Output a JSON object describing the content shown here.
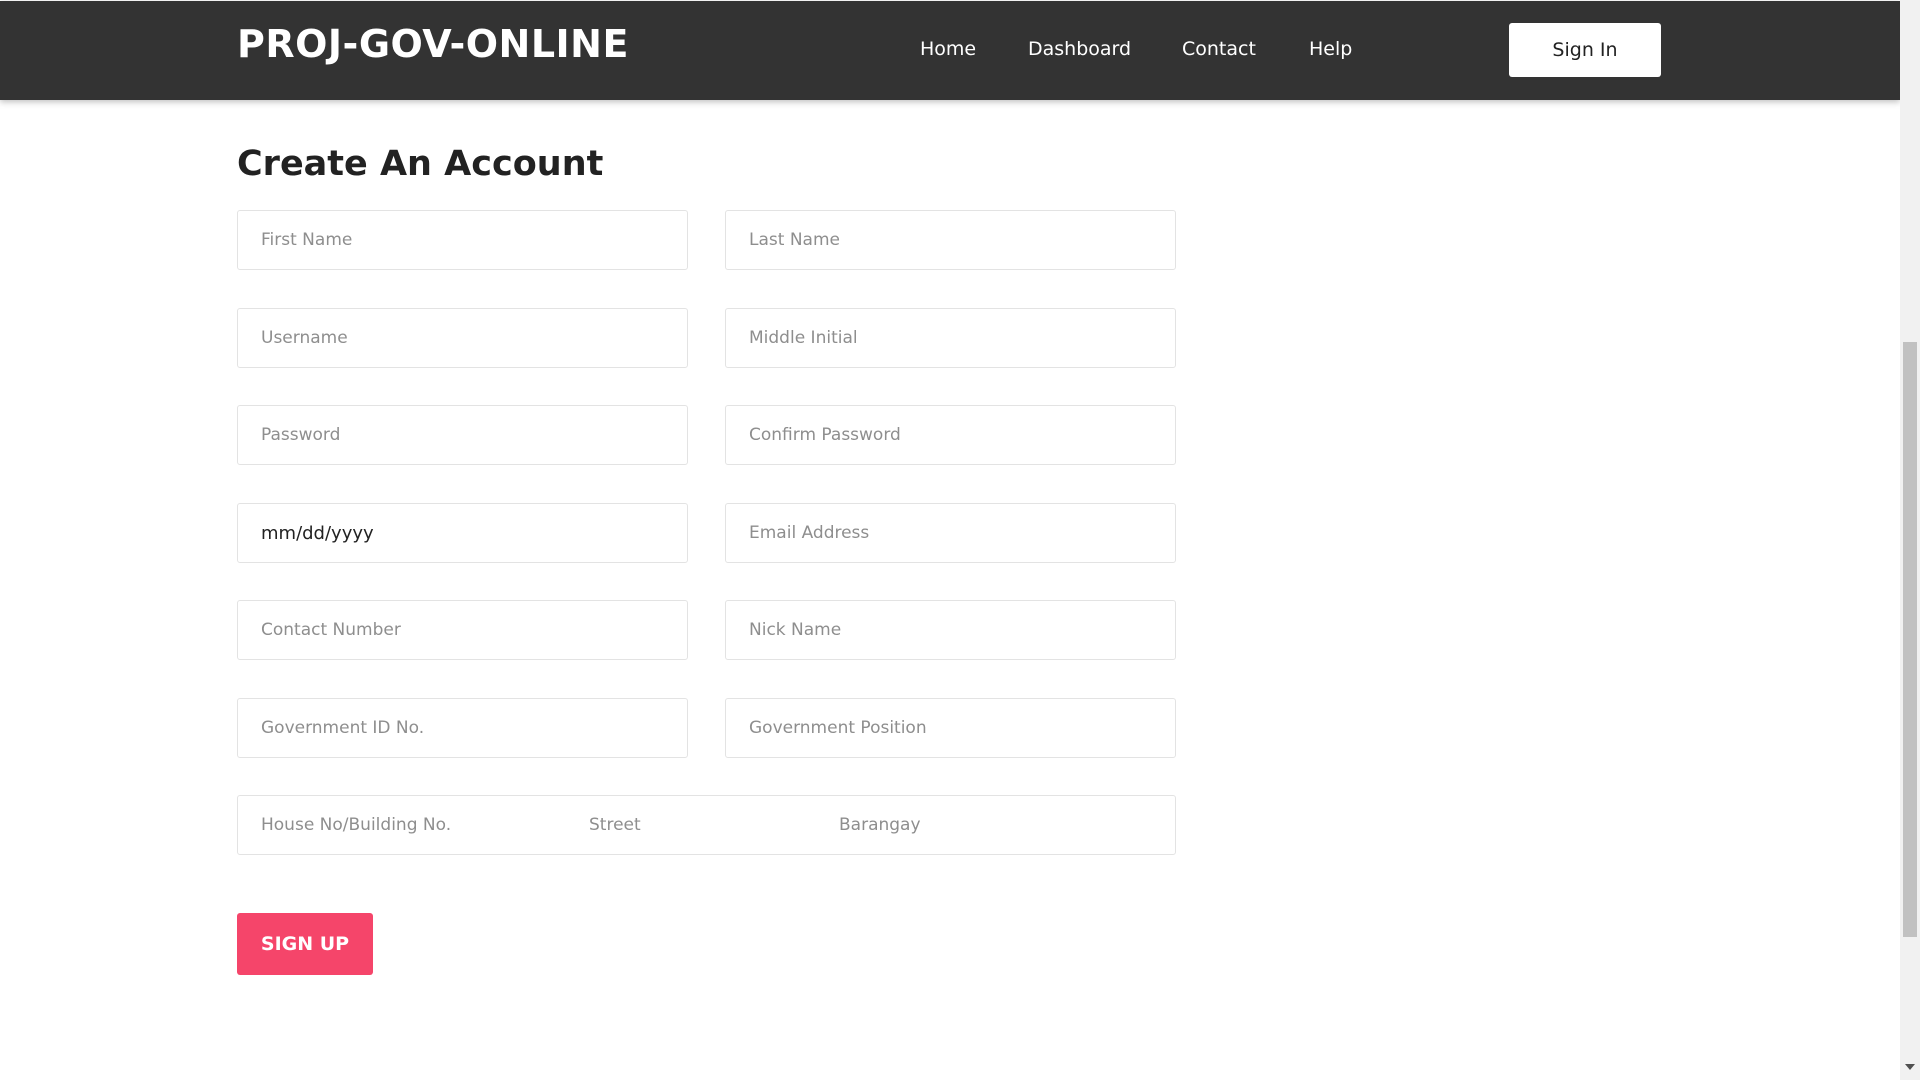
{
  "navbar": {
    "brand": "PROJ-GOV-ONLINE",
    "links": [
      "Home",
      "Dashboard",
      "Contact",
      "Help"
    ],
    "signin_label": "Sign In"
  },
  "form": {
    "title": "Create An Account",
    "placeholders": {
      "first_name": "First Name",
      "last_name": "Last Name",
      "username": "Username",
      "middle_initial": "Middle Initial",
      "password": "Password",
      "confirm_password": "Confirm Password",
      "birthdate": "mm/dd/yyyy",
      "email": "Email Address",
      "contact_number": "Contact Number",
      "nick_name": "Nick Name",
      "gov_id": "Government ID No.",
      "gov_position": "Government Position",
      "house_no": "House No/Building No.",
      "street": "Street",
      "barangay": "Barangay"
    },
    "submit_label": "SIGN UP"
  },
  "colors": {
    "navbar_bg": "#333333",
    "accent": "#f5456a"
  }
}
